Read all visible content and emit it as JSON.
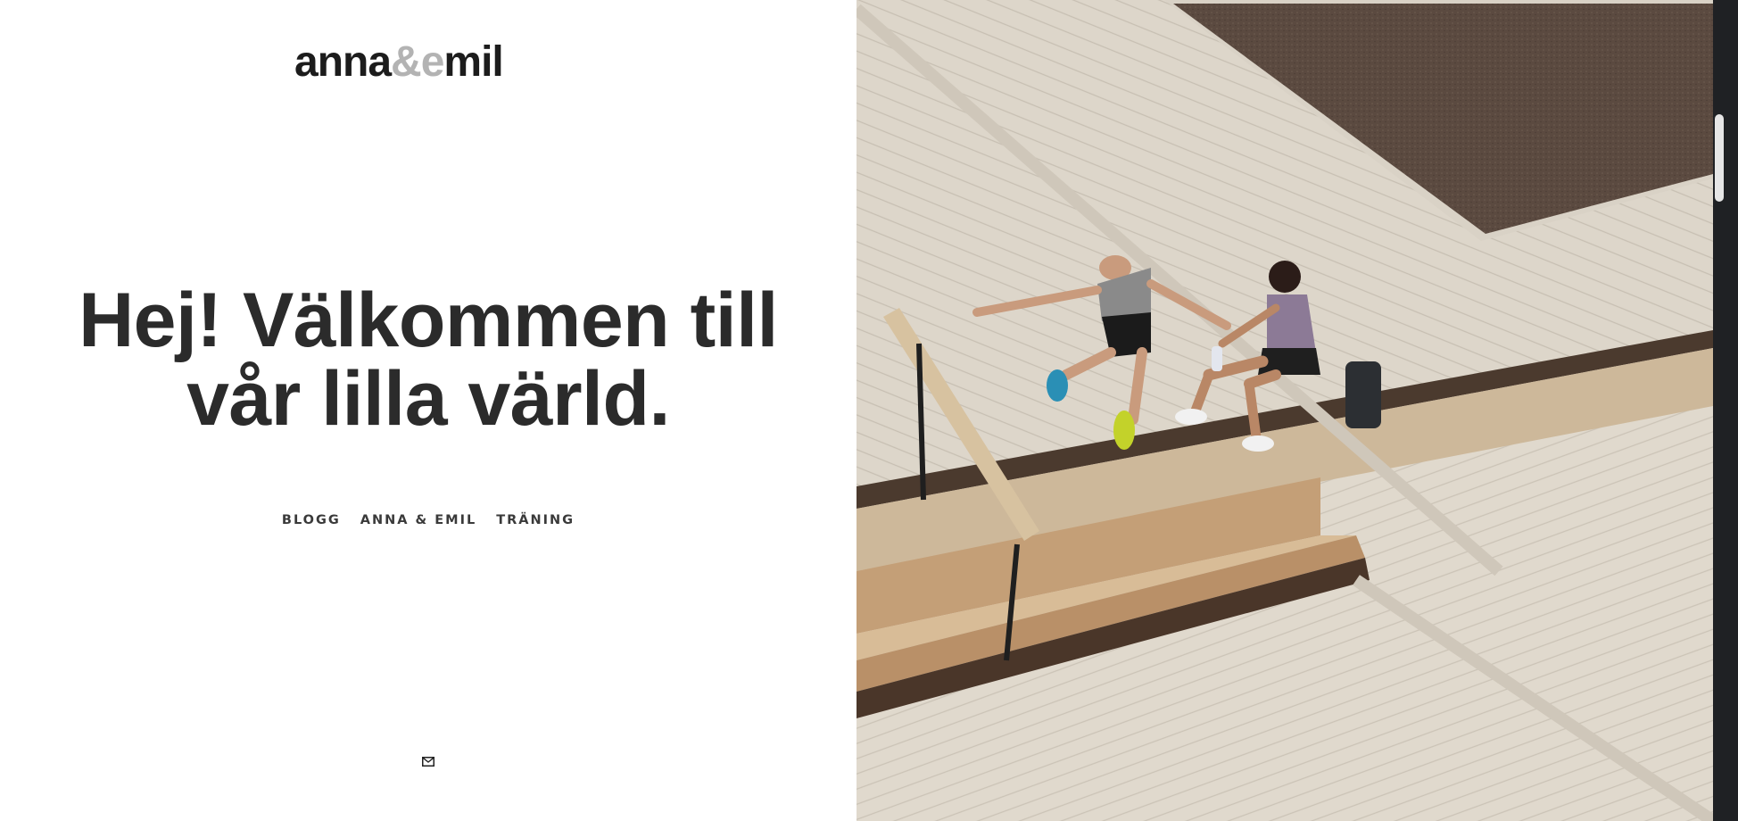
{
  "logo": {
    "part1": "anna",
    "part2": "&e",
    "part3": "mil"
  },
  "headline": {
    "line1": "Hej! Välkommen till",
    "line2": "vår lilla värld."
  },
  "nav": {
    "items": [
      {
        "label": "BLOGG"
      },
      {
        "label": "ANNA & EMIL"
      },
      {
        "label": "TRÄNING"
      }
    ]
  },
  "icons": {
    "mail": "mail-icon"
  },
  "colors": {
    "text": "#2b2b2b",
    "logo_dark": "#1c1c1c",
    "logo_light": "#b3b3b3",
    "deck": "#ded7cb",
    "soil": "#5b4a40"
  }
}
